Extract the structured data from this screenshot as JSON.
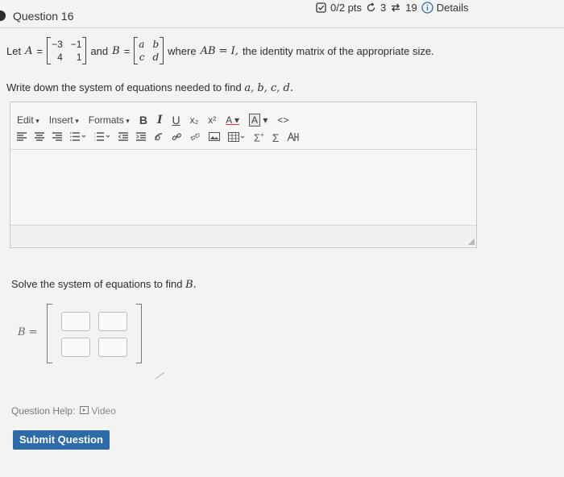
{
  "question": {
    "title": "Question 16"
  },
  "header": {
    "points": "0/2 pts",
    "retries": "3",
    "attempts": "19",
    "details_label": "Details"
  },
  "problem": {
    "let_prefix": "Let",
    "A_label": "A",
    "A_matrix": [
      "−3",
      "−1",
      "4",
      "1"
    ],
    "and_text": "and",
    "B_label": "B",
    "B_matrix": [
      "a",
      "b",
      "c",
      "d"
    ],
    "where_text": "where",
    "equation": "AB = I,",
    "suffix": "the identity matrix of the appropriate size.",
    "instruction_text": "Write down the system of equations needed to find",
    "instruction_vars": "a, b, c, d."
  },
  "editor": {
    "menus": [
      "Edit",
      "Insert",
      "Formats"
    ],
    "format_buttons": [
      "B",
      "I",
      "U",
      "x₂",
      "x²",
      "A",
      "A",
      "<>"
    ],
    "value": ""
  },
  "answer": {
    "prompt": "Solve the system of equations to find",
    "prompt_var": "B.",
    "matrix_label": "B ="
  },
  "help": {
    "label": "Question Help:",
    "video_label": "Video"
  },
  "submit_label": "Submit Question",
  "colors": {
    "submit_bg": "#2d6ca8",
    "background": "#f3f3f1"
  }
}
